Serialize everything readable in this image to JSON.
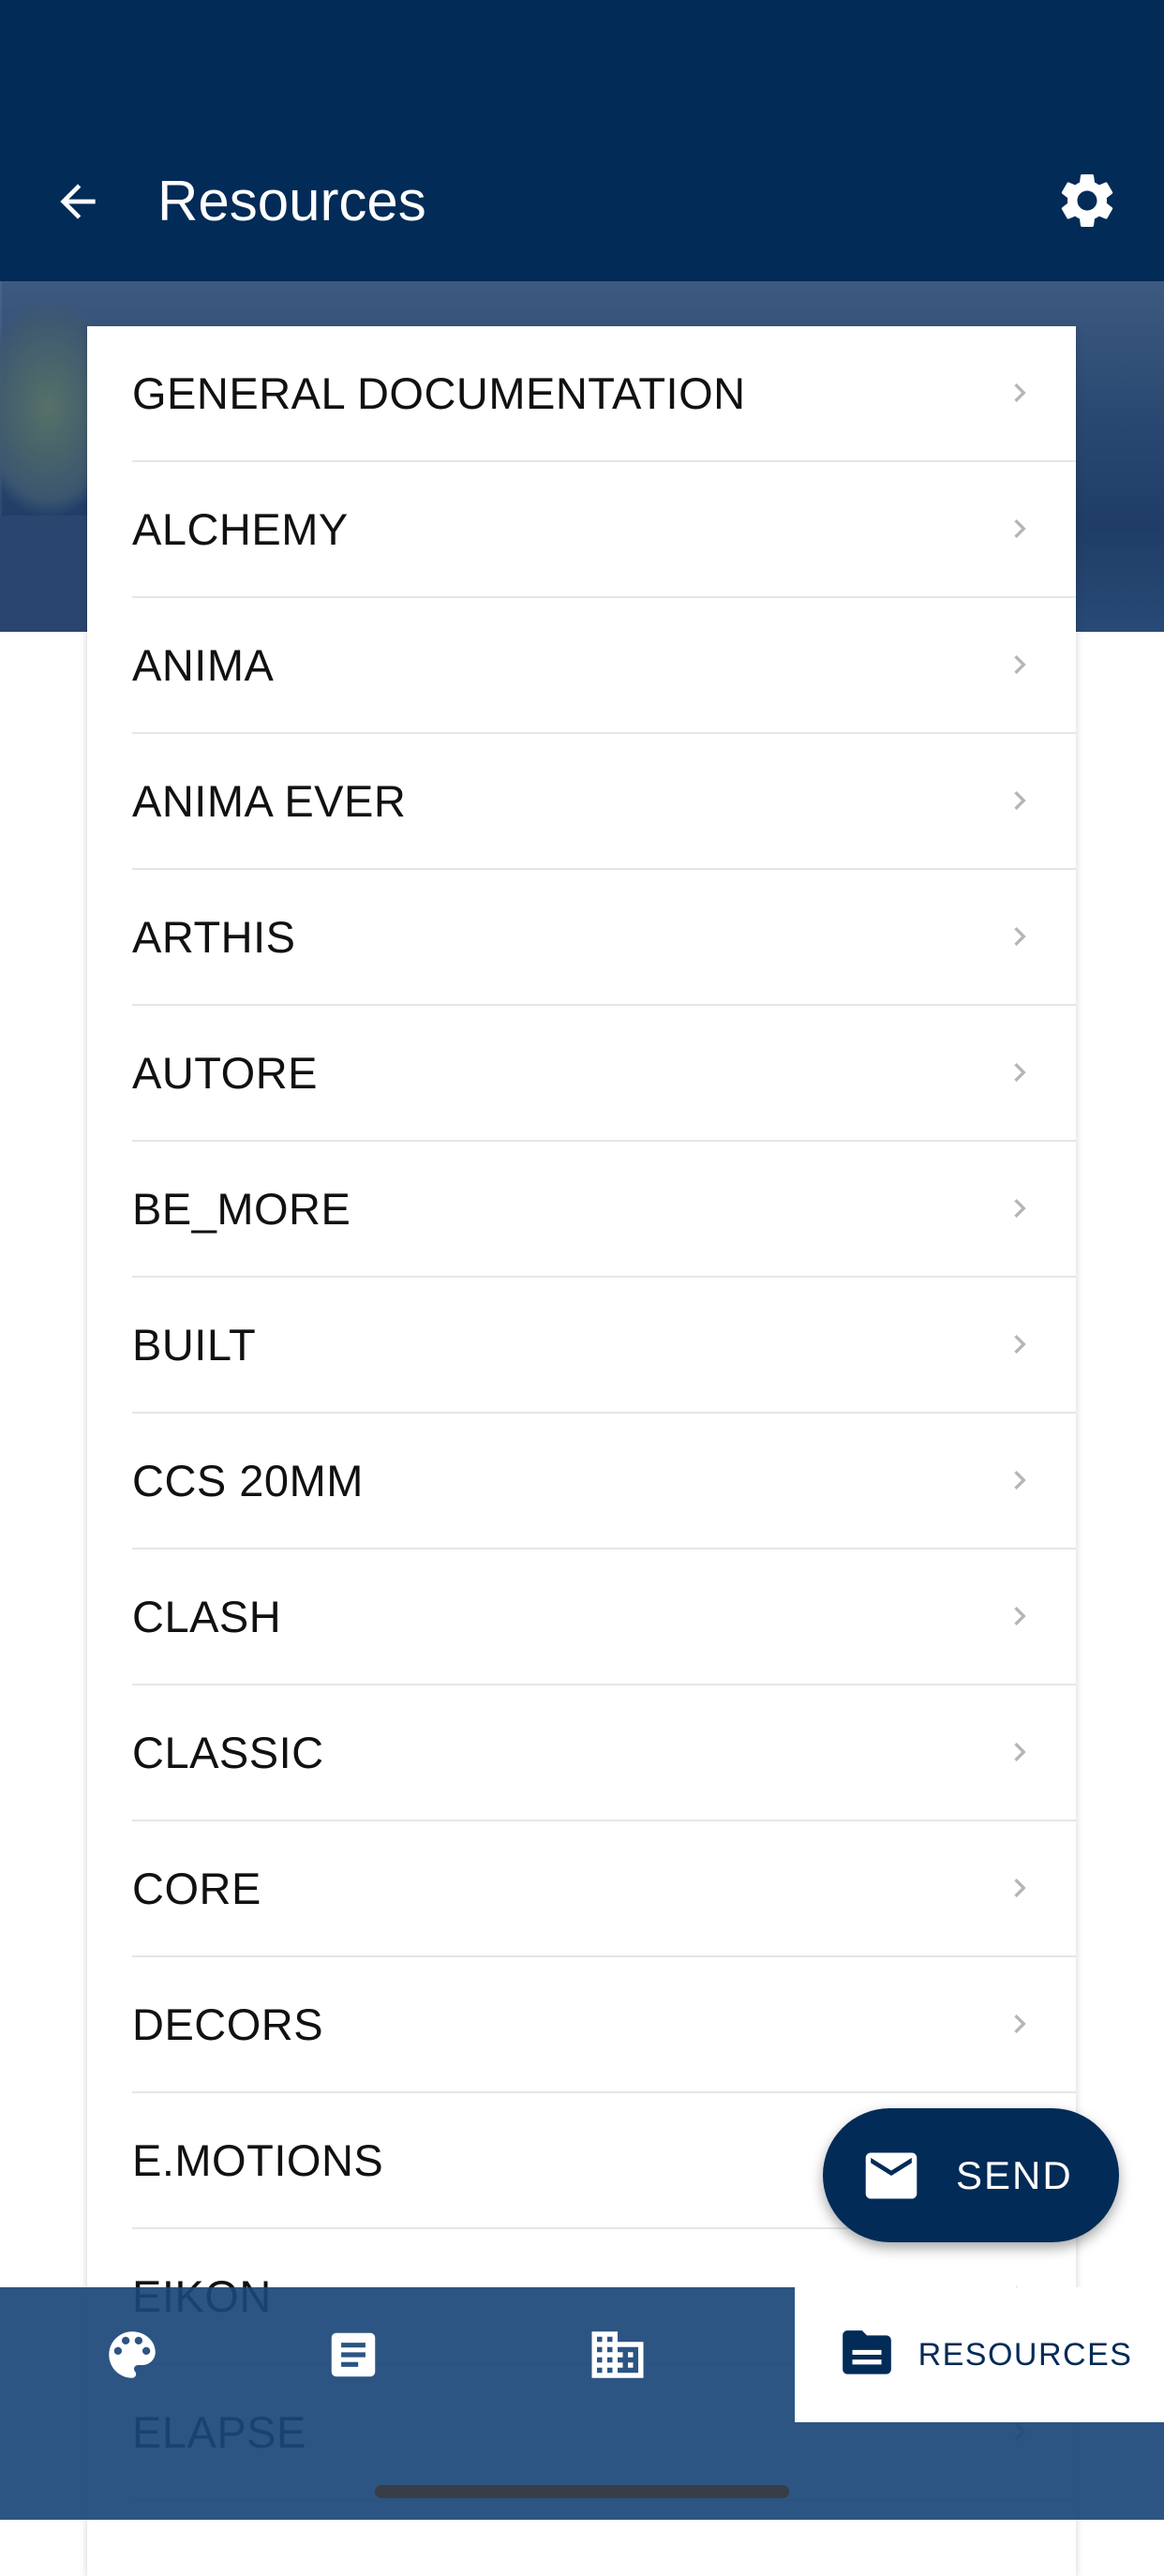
{
  "app_bar": {
    "title": "Resources"
  },
  "list": {
    "items": [
      "GENERAL DOCUMENTATION",
      "ALCHEMY",
      "ANIMA",
      "ANIMA EVER",
      "ARTHIS",
      "AUTORE",
      "BE_MORE",
      "BUILT",
      "CCS 20MM",
      "CLASH",
      "CLASSIC",
      "CORE",
      "DECORS",
      "E.MOTIONS",
      "EIKON",
      "ELAPSE"
    ]
  },
  "fab": {
    "label": "SEND",
    "icon": "mail-icon"
  },
  "bottom_nav": {
    "items": [
      {
        "icon": "palette-icon"
      },
      {
        "icon": "document-icon"
      },
      {
        "icon": "building-icon"
      },
      {
        "icon": "folder-icon",
        "label": "RESOURCES",
        "active": true
      }
    ]
  },
  "colors": {
    "primary": "#022b57",
    "nav_background": "#1a4678",
    "text": "#111111"
  }
}
